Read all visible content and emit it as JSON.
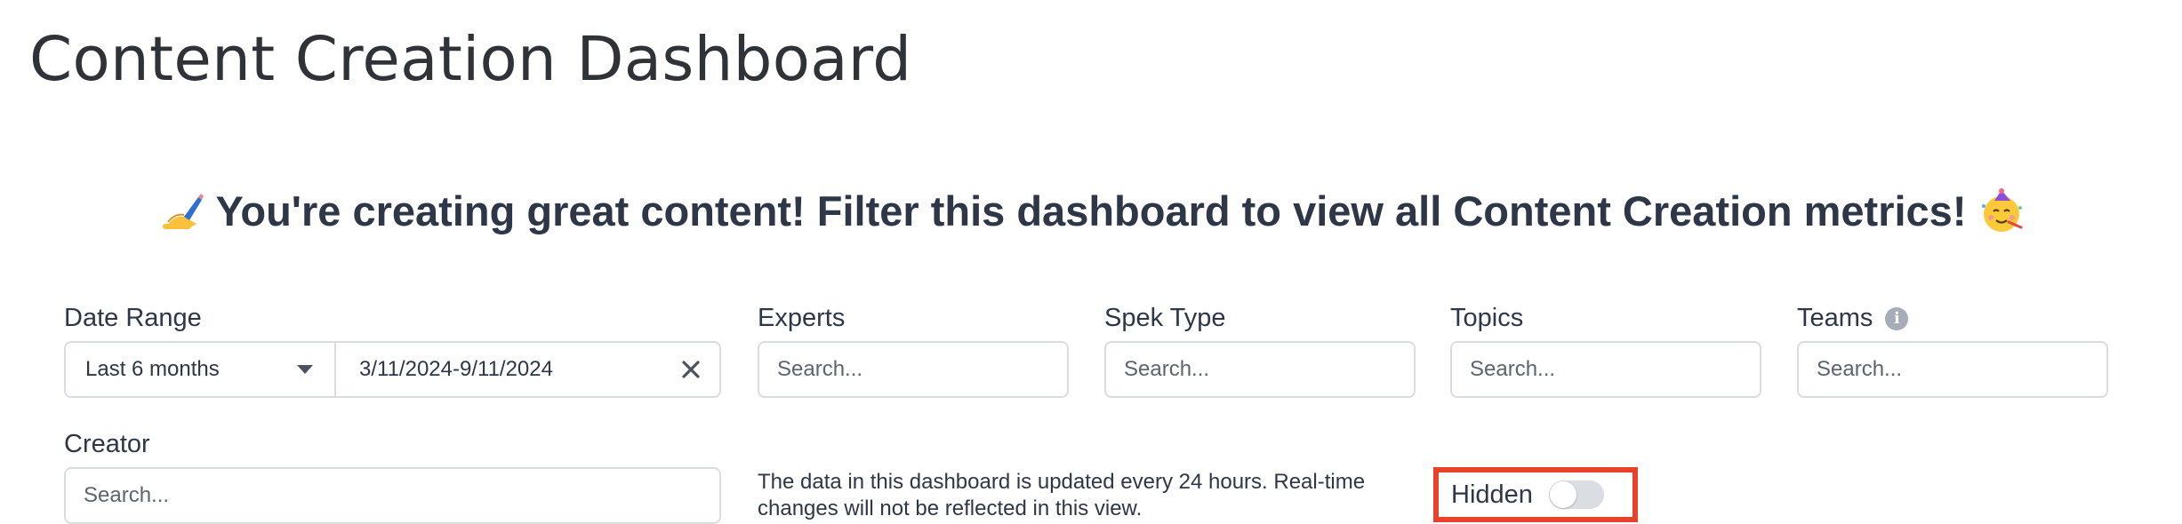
{
  "page": {
    "title": "Content Creation Dashboard"
  },
  "banner": {
    "leading_emoji": "writing-hand",
    "text": "You're creating great content! Filter this dashboard to view all Content Creation metrics!",
    "trailing_emoji": "partying-face"
  },
  "filters": {
    "date_range": {
      "label": "Date Range",
      "selected_preset": "Last 6 months",
      "value": "3/11/2024-9/11/2024"
    },
    "experts": {
      "label": "Experts",
      "placeholder": "Search..."
    },
    "spek_type": {
      "label": "Spek Type",
      "placeholder": "Search..."
    },
    "topics": {
      "label": "Topics",
      "placeholder": "Search..."
    },
    "teams": {
      "label": "Teams",
      "placeholder": "Search...",
      "info_icon": "info-icon"
    },
    "creator": {
      "label": "Creator",
      "placeholder": "Search..."
    }
  },
  "notice": {
    "line1": "The data in this dashboard is updated every 24 hours. Real-time",
    "line2": "changes will not be reflected in this view."
  },
  "visibility_toggle": {
    "label": "Hidden",
    "state": "off",
    "highlight_color": "#e8412c"
  },
  "colors": {
    "text": "#2d3748",
    "border": "#d9dde3",
    "toggle_track": "#dadde2"
  }
}
